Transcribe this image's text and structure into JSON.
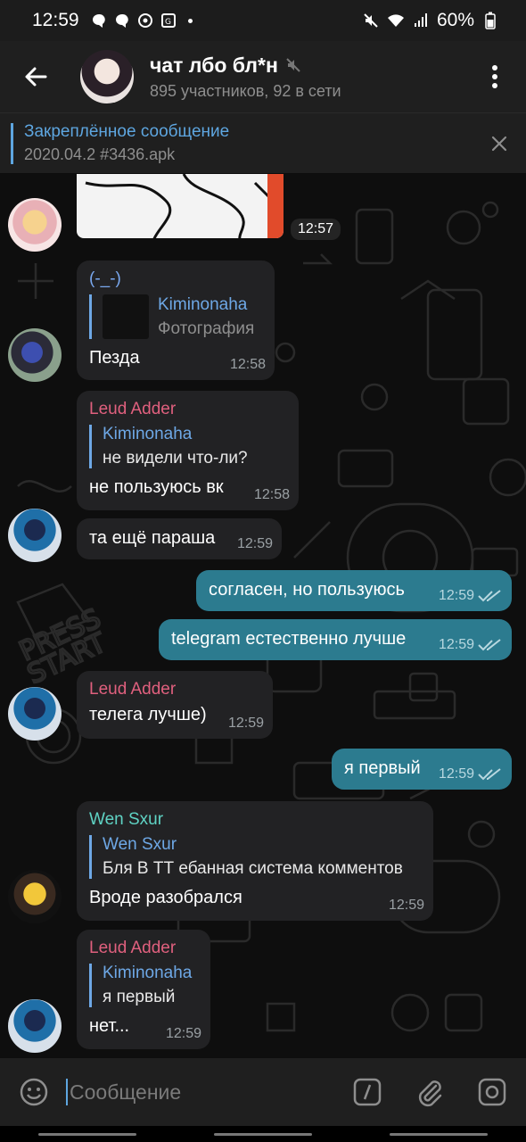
{
  "status_bar": {
    "time": "12:59",
    "battery": "60%",
    "icons": [
      "chat-notification-icon",
      "chat-notification-icon",
      "whatsapp-icon",
      "translate-icon",
      "dot-icon",
      "mute-icon",
      "wifi-icon",
      "signal-icon",
      "battery-icon"
    ]
  },
  "header": {
    "title": "чат лбо бл*н",
    "subtitle": "895 участников, 92 в сети",
    "icons": [
      "back-arrow-icon",
      "muted-icon",
      "more-vert-icon"
    ]
  },
  "pinned": {
    "title": "Закреплённое сообщение",
    "text": "2020.04.2 #3436.apk"
  },
  "colors": {
    "accent": "#5ea6e0",
    "outgoing_bubble": "#2c7b8f",
    "incoming_bubble": "#222224",
    "name_leud": "#e0607e",
    "name_wen": "#5fd3c4"
  },
  "messages": [
    {
      "id": "m1",
      "type": "image",
      "time": "12:57"
    },
    {
      "id": "m2",
      "sender": "(-_-)",
      "reply_name": "Kiminonaha",
      "reply_text": "Фотография",
      "text": "Пезда",
      "time": "12:58"
    },
    {
      "id": "m3",
      "sender": "Leud Adder",
      "reply_name": "Kiminonaha",
      "reply_text": "не видели что-ли?",
      "text": "не пользуюсь вк",
      "time": "12:58"
    },
    {
      "id": "m4",
      "text": "та ещё параша",
      "time": "12:59"
    },
    {
      "id": "m5",
      "out": true,
      "text": "согласен, но пользуюсь",
      "time": "12:59"
    },
    {
      "id": "m6",
      "out": true,
      "text": "telegram естественно лучше",
      "time": "12:59"
    },
    {
      "id": "m7",
      "sender": "Leud Adder",
      "text": "телега лучше)",
      "time": "12:59"
    },
    {
      "id": "m8",
      "out": true,
      "text": "я первый",
      "time": "12:59"
    },
    {
      "id": "m9",
      "sender": "Wen Sxur",
      "reply_name": "Wen Sxur",
      "reply_text": "Бля В ТТ ебанная система комментов",
      "text": "Вроде разобрался",
      "time": "12:59"
    },
    {
      "id": "m10",
      "sender": "Leud Adder",
      "reply_name": "Kiminonaha",
      "reply_text": "я первый",
      "text": "нет...",
      "time": "12:59"
    }
  ],
  "composer": {
    "placeholder": "Сообщение",
    "icons": [
      "emoji-icon",
      "bot-command-icon",
      "attach-icon",
      "camera-icon"
    ]
  }
}
